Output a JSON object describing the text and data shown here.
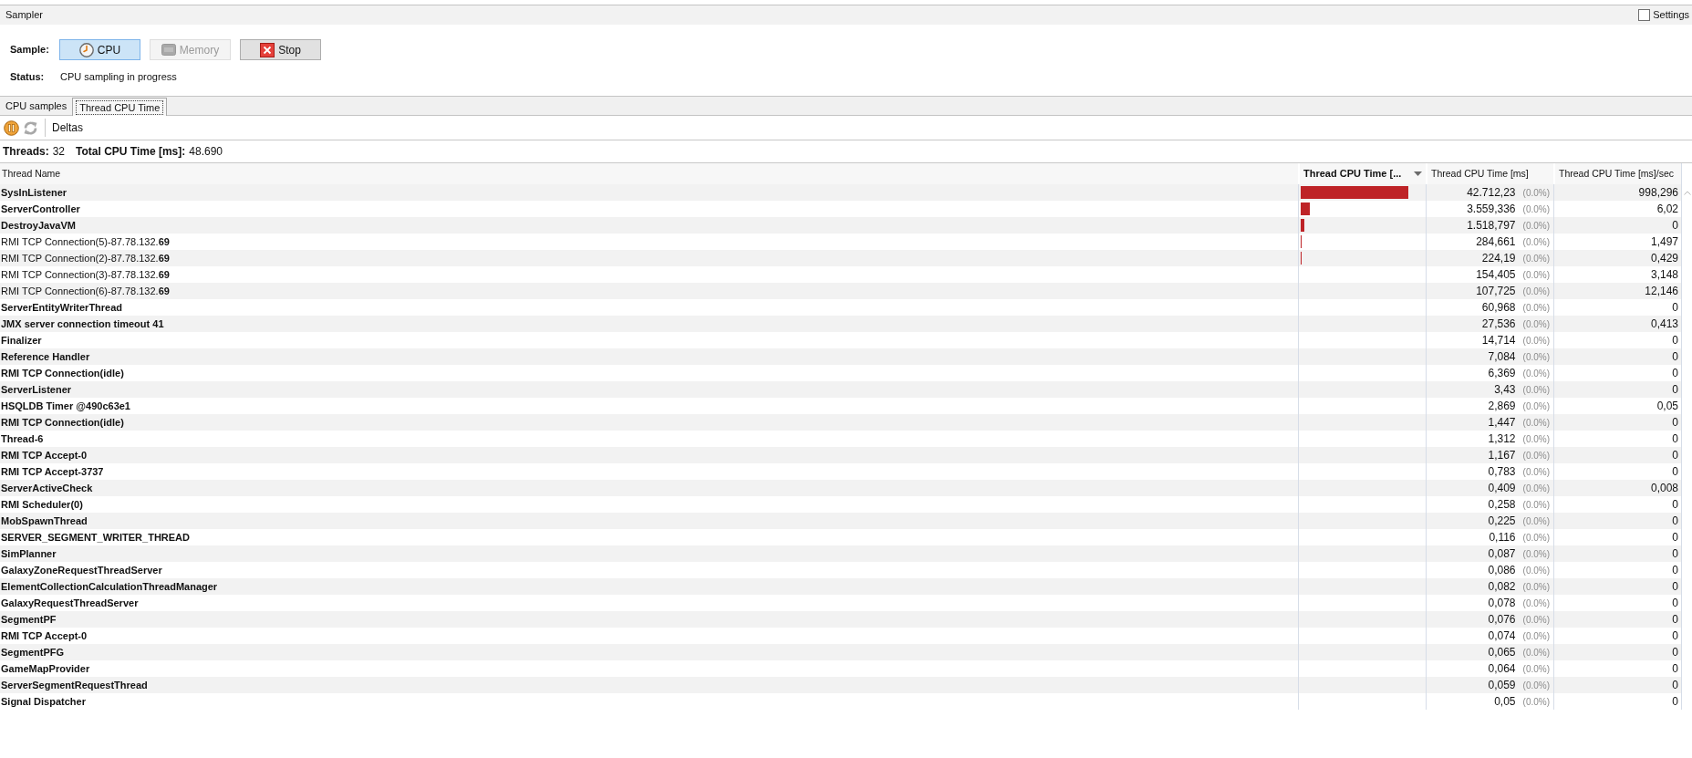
{
  "panel": {
    "title": "Sampler",
    "settings": {
      "label": "Settings",
      "checked": false
    }
  },
  "sample": {
    "label": "Sample:",
    "buttons": [
      {
        "label": "CPU",
        "kind": "cpu",
        "selected": true,
        "disabled": false
      },
      {
        "label": "Memory",
        "kind": "memory",
        "selected": false,
        "disabled": true
      },
      {
        "label": "Stop",
        "kind": "stop",
        "selected": false,
        "disabled": false
      }
    ]
  },
  "status": {
    "label": "Status:",
    "value": "CPU sampling in progress"
  },
  "tabs": [
    {
      "label": "CPU samples",
      "selected": false
    },
    {
      "label": "Thread CPU Time",
      "selected": true
    }
  ],
  "toolbar": {
    "buttons": [
      {
        "kind": "pause",
        "disabled": false
      },
      {
        "kind": "refresh",
        "disabled": true
      }
    ],
    "deltas": "Deltas"
  },
  "summary": [
    {
      "label": "Threads:",
      "value": "32"
    },
    {
      "label": "Total CPU Time [ms]:",
      "value": "48.690"
    }
  ],
  "table": {
    "columns": [
      {
        "label": "Thread Name",
        "sorted": false
      },
      {
        "label": "Thread CPU Time [...",
        "sorted": true
      },
      {
        "label": "Thread CPU Time [ms]",
        "sorted": false
      },
      {
        "label": "Thread CPU Time [ms]/sec",
        "sorted": false
      }
    ],
    "rows": [
      {
        "name": "SysInListener",
        "bold": true,
        "level": 0.877,
        "time": "42.712,23",
        "percent": "(0.0%)",
        "rate": "998,296"
      },
      {
        "name": "ServerController",
        "bold": true,
        "level": 0.073,
        "time": "3.559,336",
        "percent": "(0.0%)",
        "rate": "6,02"
      },
      {
        "name": "DestroyJavaVM",
        "bold": true,
        "level": 0.031,
        "time": "1.518,797",
        "percent": "(0.0%)",
        "rate": "0"
      },
      {
        "name": "RMI TCP Connection(5)-87.78.132.**69**",
        "bold": false,
        "level": 0.006,
        "time": "284,661",
        "percent": "(0.0%)",
        "rate": "1,497"
      },
      {
        "name": "RMI TCP Connection(2)-87.78.132.**69**",
        "bold": false,
        "level": 0.005,
        "time": "224,19",
        "percent": "(0.0%)",
        "rate": "0,429"
      },
      {
        "name": "RMI TCP Connection(3)-87.78.132.**69**",
        "bold": false,
        "time": "154,405",
        "percent": "(0.0%)",
        "rate": "3,148"
      },
      {
        "name": "RMI TCP Connection(6)-87.78.132.**69**",
        "bold": false,
        "time": "107,725",
        "percent": "(0.0%)",
        "rate": "12,146"
      },
      {
        "name": "ServerEntityWriterThread",
        "bold": true,
        "time": "60,968",
        "percent": "(0.0%)",
        "rate": "0"
      },
      {
        "name": "JMX server connection timeout 41",
        "bold": true,
        "time": "27,536",
        "percent": "(0.0%)",
        "rate": "0,413"
      },
      {
        "name": "Finalizer",
        "bold": true,
        "time": "14,714",
        "percent": "(0.0%)",
        "rate": "0"
      },
      {
        "name": "Reference Handler",
        "bold": true,
        "time": "7,084",
        "percent": "(0.0%)",
        "rate": "0"
      },
      {
        "name": "RMI TCP Connection(idle)",
        "bold": true,
        "time": "6,369",
        "percent": "(0.0%)",
        "rate": "0"
      },
      {
        "name": "ServerListener",
        "bold": true,
        "time": "3,43",
        "percent": "(0.0%)",
        "rate": "0"
      },
      {
        "name": "HSQLDB Timer @490c63e1",
        "bold": true,
        "time": "2,869",
        "percent": "(0.0%)",
        "rate": "0,05"
      },
      {
        "name": "RMI TCP Connection(idle)",
        "bold": true,
        "time": "1,447",
        "percent": "(0.0%)",
        "rate": "0"
      },
      {
        "name": "Thread-6",
        "bold": true,
        "time": "1,312",
        "percent": "(0.0%)",
        "rate": "0"
      },
      {
        "name": "RMI TCP Accept-0",
        "bold": true,
        "time": "1,167",
        "percent": "(0.0%)",
        "rate": "0"
      },
      {
        "name": "RMI TCP Accept-3737",
        "bold": true,
        "time": "0,783",
        "percent": "(0.0%)",
        "rate": "0"
      },
      {
        "name": "ServerActiveCheck",
        "bold": true,
        "time": "0,409",
        "percent": "(0.0%)",
        "rate": "0,008"
      },
      {
        "name": "RMI Scheduler(0)",
        "bold": true,
        "time": "0,258",
        "percent": "(0.0%)",
        "rate": "0"
      },
      {
        "name": "MobSpawnThread",
        "bold": true,
        "time": "0,225",
        "percent": "(0.0%)",
        "rate": "0"
      },
      {
        "name": "SERVER_SEGMENT_WRITER_THREAD",
        "bold": true,
        "time": "0,116",
        "percent": "(0.0%)",
        "rate": "0"
      },
      {
        "name": "SimPlanner",
        "bold": true,
        "time": "0,087",
        "percent": "(0.0%)",
        "rate": "0"
      },
      {
        "name": "GalaxyZoneRequestThreadServer",
        "bold": true,
        "time": "0,086",
        "percent": "(0.0%)",
        "rate": "0"
      },
      {
        "name": "ElementCollectionCalculationThreadManager",
        "bold": true,
        "time": "0,082",
        "percent": "(0.0%)",
        "rate": "0"
      },
      {
        "name": "GalaxyRequestThreadServer",
        "bold": true,
        "time": "0,078",
        "percent": "(0.0%)",
        "rate": "0"
      },
      {
        "name": "SegmentPF",
        "bold": true,
        "time": "0,076",
        "percent": "(0.0%)",
        "rate": "0"
      },
      {
        "name": "RMI TCP Accept-0",
        "bold": true,
        "time": "0,074",
        "percent": "(0.0%)",
        "rate": "0"
      },
      {
        "name": "SegmentPFG",
        "bold": true,
        "time": "0,065",
        "percent": "(0.0%)",
        "rate": "0"
      },
      {
        "name": "GameMapProvider",
        "bold": true,
        "time": "0,064",
        "percent": "(0.0%)",
        "rate": "0"
      },
      {
        "name": "ServerSegmentRequestThread",
        "bold": true,
        "time": "0,059",
        "percent": "(0.0%)",
        "rate": "0"
      },
      {
        "name": "Signal Dispatcher",
        "bold": true,
        "time": "0,05",
        "percent": "(0.0%)",
        "rate": "0"
      }
    ]
  }
}
